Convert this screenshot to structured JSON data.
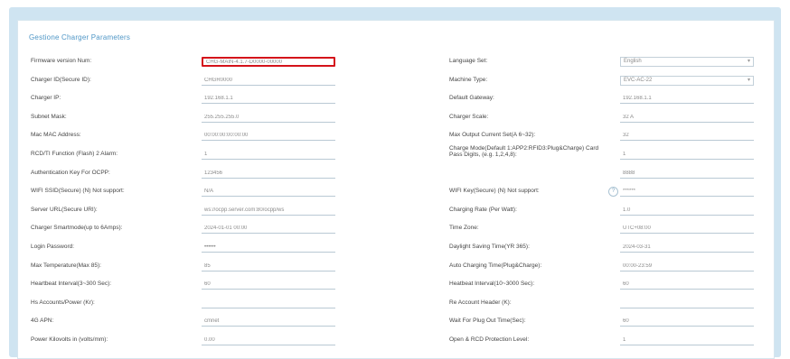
{
  "section": {
    "title": "Gestione Charger Parameters"
  },
  "left_fields": [
    {
      "label": "Firmware version Num:",
      "value": "CHG-MAIN-4.1.7-D0000-00000"
    },
    {
      "label": "Charger ID(Secure ID):",
      "value": "CHGR0000"
    },
    {
      "label": "Charger IP:",
      "value": "192.168.1.1"
    },
    {
      "label": "Subnet Mask:",
      "value": "255.255.255.0"
    },
    {
      "label": "Mac MAC Address:",
      "value": "00:00:00:00:00:00"
    },
    {
      "label": "RCD/TI Function (Flash) 2 Alarm:",
      "value": "1"
    },
    {
      "label": "Authentication Key For OCPP:",
      "value": "123456"
    },
    {
      "label": "WIFI SSID(Secure) (N) Not support:",
      "value": "N/A"
    },
    {
      "label": "Server URL(Secure URI):",
      "value": "ws://ocpp.server.com:80/ocpp/ws"
    },
    {
      "label": "Charger Smartmode(up to 6Amps):",
      "value": "2024-01-01 00:00"
    },
    {
      "label": "Login Password:",
      "value": "••••••"
    },
    {
      "label": "Max Temperature(Max 85):",
      "value": "85"
    },
    {
      "label": "Heartbeat Interval(3~300 Sec):",
      "value": "60"
    },
    {
      "label": "Hs Accounts/Power (Kr):",
      "value": ""
    },
    {
      "label": "4G APN:",
      "value": "cmnet"
    },
    {
      "label": "Power Kilovolts in (volts/mm):",
      "value": "0.00"
    }
  ],
  "right_fields": [
    {
      "label": "Language Set:",
      "value": "English",
      "type": "select"
    },
    {
      "label": "Machine Type:",
      "value": "EVC-AC-22",
      "type": "select"
    },
    {
      "label": "Default Gateway:",
      "value": "192.168.1.1"
    },
    {
      "label": "Charger Scale:",
      "value": "32 A"
    },
    {
      "label": "Max Output Current Set(A 6~32):",
      "value": "32"
    },
    {
      "label": "Charge Mode(Default 1:APP2:RFID3:Plug&Charge) Card Pass Digits, (e.g. 1,2,4,8):",
      "value": "1",
      "multi": true
    },
    {
      "label": "",
      "value": "8888"
    },
    {
      "label": "WIFI Key(Secure) (N) Not support:",
      "value": "******",
      "help": true
    },
    {
      "label": "Charging Rate (Per Watt):",
      "value": "1.0"
    },
    {
      "label": "Time Zone:",
      "value": "UTC+08:00"
    },
    {
      "label": "Daylight Saving Time(YR 365):",
      "value": "2024-03-31"
    },
    {
      "label": "Auto Charging Time(Plug&Charge):",
      "value": "00:00-23:59"
    },
    {
      "label": "Heatbeat Interval(10~3000 Sec):",
      "value": "60"
    },
    {
      "label": "Re Account Header (K):",
      "value": ""
    },
    {
      "label": "Wait For Plug Out Time(Sec):",
      "value": "60"
    },
    {
      "label": "Open & RCD Protection Level:",
      "value": "1"
    }
  ],
  "icons": {
    "select_chevron": "chevron-down-icon",
    "help": "help-icon"
  },
  "colors": {
    "frame": "#cfe4f1",
    "title": "#4f96c6",
    "highlight": "#d4121a"
  }
}
